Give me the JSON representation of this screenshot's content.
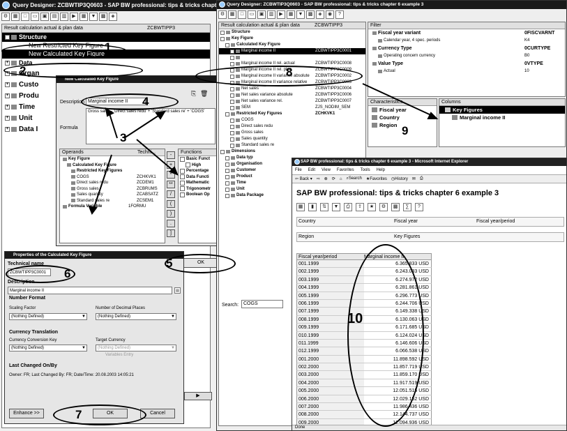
{
  "outer": {
    "title": "Query Designer: ZCBWTIP3Q0603 - SAP BW professional: tips & tricks chapter 6 example 3"
  },
  "left": {
    "header_col1": "Result calculation actual & plan data",
    "header_col2": "ZCBWTIPP3",
    "tree": [
      "Structure",
      "New Restricted Key Figure",
      "New Calculated Key Figure",
      "Data",
      "Organ",
      "Custo",
      "Produ",
      "Time",
      "Unit",
      "Data I"
    ]
  },
  "ckf_dialog": {
    "title": "New Calculated Key Figure",
    "description_label": "Description",
    "description_value": "Marginal income II",
    "formula_label": "Formula",
    "formula_value": "Gross sales - 'Direct sales redu' + 'Standard sales re' + 'COGS'",
    "operands_header": "Operands",
    "techn_header": "Techni...",
    "functions_header": "Functions",
    "operands": [
      {
        "name": "Key Figure",
        "code": ""
      },
      {
        "name": "Calculated Key Figure",
        "code": ""
      },
      {
        "name": "Restricted Key Figures",
        "code": ""
      },
      {
        "name": "COGS",
        "code": "ZCHKVK1"
      },
      {
        "name": "Direct sales redu",
        "code": "ZCDEM1"
      },
      {
        "name": "Gross sales",
        "code": "ZCBRUMS"
      },
      {
        "name": "Sales quantity",
        "code": "ZCABSATZ"
      },
      {
        "name": "Standard sales re",
        "code": "ZCSEM1"
      },
      {
        "name": "Formula Variable",
        "code": "1FORMU"
      }
    ],
    "functions": [
      "Basic Funct",
      "High",
      "Percentage",
      "Data Functi",
      "Mathematic",
      "Trigonometr",
      "Boolean Op"
    ],
    "ops": [
      "-",
      "+",
      "*",
      "**",
      "/",
      "(",
      ")",
      ".",
      "]"
    ],
    "ok": "OK"
  },
  "props_dialog": {
    "title": "Properties of the Calculated Key Figure",
    "tech_label": "Technical name",
    "tech_value": "ZCBWTIPP3C0001",
    "desc_label": "Description",
    "desc_value": "Marginal income II",
    "number_format": "Number Format",
    "scaling_label": "Scaling Factor",
    "scaling_value": "(Nothing Defined)",
    "decimal_label": "Number of Decimal Places",
    "decimal_value": "(Nothing Defined)",
    "currency_section": "Currency Translation",
    "conv_key_label": "Currency Conversion Key",
    "conv_key_value": "(Nothing Defined)",
    "target_label": "Target Currency",
    "target_value": "(Nothing Defined)",
    "variables_entry": "Variables Entry",
    "last_changed_section": "Last Changed On/By",
    "last_changed_text": "Owner: FR; Last Changed By: FR; Date/Time: 20.08.2003 14:05:21",
    "enhance": "Enhance >>",
    "ok": "OK",
    "cancel": "Cancel"
  },
  "right_designer": {
    "title": "Query Designer: ZCBWTIP3Q0603 - SAP BW professional: tips & tricks chapter 6 example 3",
    "header_col1": "Result calculation actual & plan data",
    "header_col2": "ZCBWTIPP3",
    "tree": [
      {
        "name": "Structure",
        "code": "",
        "level": 0
      },
      {
        "name": "Key Figure",
        "code": "",
        "level": 0
      },
      {
        "name": "Calculated Key Figure",
        "code": "",
        "level": 1
      },
      {
        "name": "Marginal income II",
        "code": "ZCBWTIPP3C0001",
        "level": 2
      },
      {
        "name": "",
        "code": "",
        "level": 2
      },
      {
        "name": "Marginal income II rel. actual",
        "code": "ZCBWTIPP3C0008",
        "level": 2
      },
      {
        "name": "Marginal income II rel. plan",
        "code": "ZCBWTIPP3C0009",
        "level": 2
      },
      {
        "name": "Marginal income II variance absolute",
        "code": "ZCBWTIPP3C0002",
        "level": 2
      },
      {
        "name": "Marginal income II variance relative",
        "code": "ZCBWTIPP3C0003",
        "level": 2
      },
      {
        "name": "Net sales",
        "code": "ZCBWTIPP3C0004",
        "level": 2
      },
      {
        "name": "Net sales variance absolute",
        "code": "ZCBWTIPP3C0006",
        "level": 2
      },
      {
        "name": "Net sales variance rel.",
        "code": "ZCBWTIPP3C0007",
        "level": 2
      },
      {
        "name": "SEM",
        "code": "ZJS_NODIM_SEM",
        "level": 2
      },
      {
        "name": "Restricted Key Figures",
        "code": "ZCHKVK1",
        "level": 1
      },
      {
        "name": "COGS",
        "code": "",
        "level": 2
      },
      {
        "name": "Direct sales redu",
        "code": "",
        "level": 2
      },
      {
        "name": "Gross sales",
        "code": "",
        "level": 2
      },
      {
        "name": "Sales quantity",
        "code": "",
        "level": 2
      },
      {
        "name": "Standard sales re",
        "code": "",
        "level": 2
      },
      {
        "name": "Dimensions",
        "code": "",
        "level": 0
      },
      {
        "name": "Data typ",
        "code": "",
        "level": 1
      },
      {
        "name": "Organisation",
        "code": "",
        "level": 1
      },
      {
        "name": "Customer",
        "code": "",
        "level": 1
      },
      {
        "name": "Product",
        "code": "",
        "level": 1
      },
      {
        "name": "Time",
        "code": "",
        "level": 1
      },
      {
        "name": "Unit",
        "code": "",
        "level": 1
      },
      {
        "name": "Data Package",
        "code": "",
        "level": 1
      }
    ],
    "search_label": "Search:",
    "search_value": "COGS",
    "filter_header": "Filter",
    "filter": [
      {
        "name": "Fiscal year variant",
        "code": "0FISCVARNT",
        "bold": true
      },
      {
        "name": "Calendar year, 4 spec. periods",
        "code": "K4",
        "bold": false
      },
      {
        "name": "Currency Type",
        "code": "0CURTYPE",
        "bold": true
      },
      {
        "name": "Operating concern currency",
        "code": "B0",
        "bold": false
      },
      {
        "name": "Value Type",
        "code": "0VTYPE",
        "bold": true
      },
      {
        "name": "Actual",
        "code": "10",
        "bold": false
      }
    ],
    "characteristics_header": "Characteristics",
    "characteristics": [
      "Fiscal year",
      "Country",
      "Region"
    ],
    "columns_header": "Columns",
    "columns": [
      "Key Figures",
      "Marginal income II"
    ]
  },
  "ie": {
    "title": "SAP BW professional: tips & tricks chapter 6 example 3 - Microsoft Internet Explorer",
    "menu": [
      "File",
      "Edit",
      "View",
      "Favorites",
      "Tools",
      "Help"
    ],
    "nav": [
      "Back",
      "Search",
      "Favorites",
      "History"
    ],
    "heading": "SAP BW professional: tips & tricks chapter 6 example 3",
    "nav_country": "Country",
    "nav_fiscal_year": "Fiscal year",
    "nav_fiscal_period": "Fiscal year/period",
    "nav_region": "Region",
    "nav_key_figures": "Key Figures",
    "col_period": "Fiscal year/period",
    "col_value": "Marginal income II",
    "rows": [
      {
        "p": "001.1999",
        "v": "6.365.833 USD"
      },
      {
        "p": "002.1999",
        "v": "6.243.033 USD"
      },
      {
        "p": "003.1999",
        "v": "6.274.972 USD"
      },
      {
        "p": "004.1999",
        "v": "6.281.861 USD"
      },
      {
        "p": "005.1999",
        "v": "6.296.773 USD"
      },
      {
        "p": "006.1999",
        "v": "6.244.706 USD"
      },
      {
        "p": "007.1999",
        "v": "6.149.338 USD"
      },
      {
        "p": "008.1999",
        "v": "6.130.063 USD"
      },
      {
        "p": "009.1999",
        "v": "6.171.685 USD"
      },
      {
        "p": "010.1999",
        "v": "6.124.024 USD"
      },
      {
        "p": "011.1999",
        "v": "6.146.606 USD"
      },
      {
        "p": "012.1999",
        "v": "6.066.538 USD"
      },
      {
        "p": "001.2000",
        "v": "11.898.592 USD"
      },
      {
        "p": "002.2000",
        "v": "11.857.719 USD"
      },
      {
        "p": "003.2000",
        "v": "11.859.170 USD"
      },
      {
        "p": "004.2000",
        "v": "11.917.519 USD"
      },
      {
        "p": "005.2000",
        "v": "12.051.515 USD"
      },
      {
        "p": "006.2000",
        "v": "12.029.152 USD"
      },
      {
        "p": "007.2000",
        "v": "11.986.436 USD"
      },
      {
        "p": "008.2000",
        "v": "12.144.737 USD"
      },
      {
        "p": "009.2000",
        "v": "12.094.936 USD"
      }
    ],
    "status": "Done"
  },
  "callouts": [
    "1",
    "2",
    "3",
    "4",
    "5",
    "6",
    "7",
    "8",
    "9",
    "10"
  ]
}
